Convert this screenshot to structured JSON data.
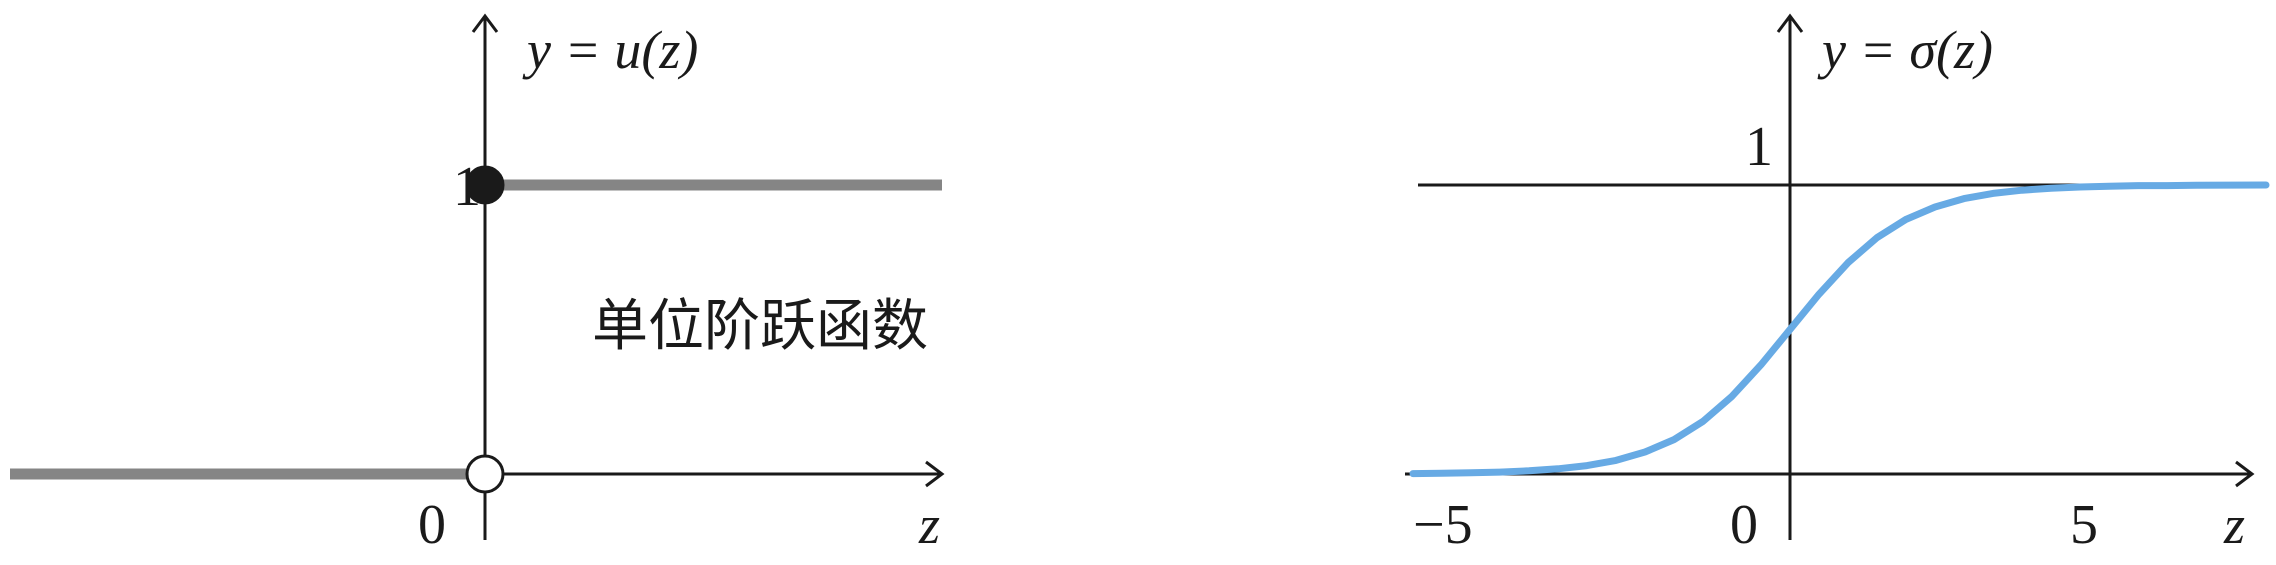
{
  "chart_data": [
    {
      "type": "line",
      "title": "",
      "curve_label": "y = u(z)",
      "annotation": "单位阶跃函数",
      "xlabel": "z",
      "ylabel": "",
      "tick_labels": {
        "x": [
          "0"
        ],
        "y": [
          "1"
        ]
      },
      "ylim": [
        0,
        1
      ],
      "segments": [
        {
          "x": [
            -1,
            0
          ],
          "y": [
            0,
            0
          ]
        },
        {
          "x": [
            0,
            1
          ],
          "y": [
            1,
            1
          ]
        }
      ],
      "points": [
        {
          "x": 0,
          "y": 1,
          "filled": true
        },
        {
          "x": 0,
          "y": 0,
          "filled": false
        }
      ],
      "grid": false,
      "colors": {
        "line": "#858585",
        "axis": "#1a1a1a",
        "point": "#1a1a1a"
      }
    },
    {
      "type": "line",
      "title": "",
      "curve_label": "y = σ(z)",
      "xlabel": "z",
      "ylabel": "",
      "tick_labels": {
        "x": [
          "−5",
          "0",
          "5"
        ],
        "y": [
          "1"
        ]
      },
      "xlim": [
        -6.5,
        7
      ],
      "ylim": [
        0,
        1
      ],
      "series": [
        {
          "x": [
            -6.5,
            -6,
            -5.5,
            -5,
            -4.5,
            -4,
            -3.5,
            -3,
            -2.5,
            -2,
            -1.5,
            -1,
            -0.5,
            0,
            0.5,
            1,
            1.5,
            2,
            2.5,
            3,
            3.5,
            4,
            4.5,
            5,
            5.5,
            6,
            6.5,
            7
          ],
          "y": [
            0.0015,
            0.0025,
            0.0041,
            0.0067,
            0.011,
            0.018,
            0.029,
            0.047,
            0.076,
            0.119,
            0.182,
            0.269,
            0.378,
            0.5,
            0.622,
            0.731,
            0.818,
            0.881,
            0.924,
            0.953,
            0.971,
            0.982,
            0.989,
            0.993,
            0.996,
            0.998,
            0.998,
            0.999
          ]
        }
      ],
      "grid": false,
      "colors": {
        "line": "#67aae4",
        "axis": "#1a1a1a"
      }
    }
  ]
}
